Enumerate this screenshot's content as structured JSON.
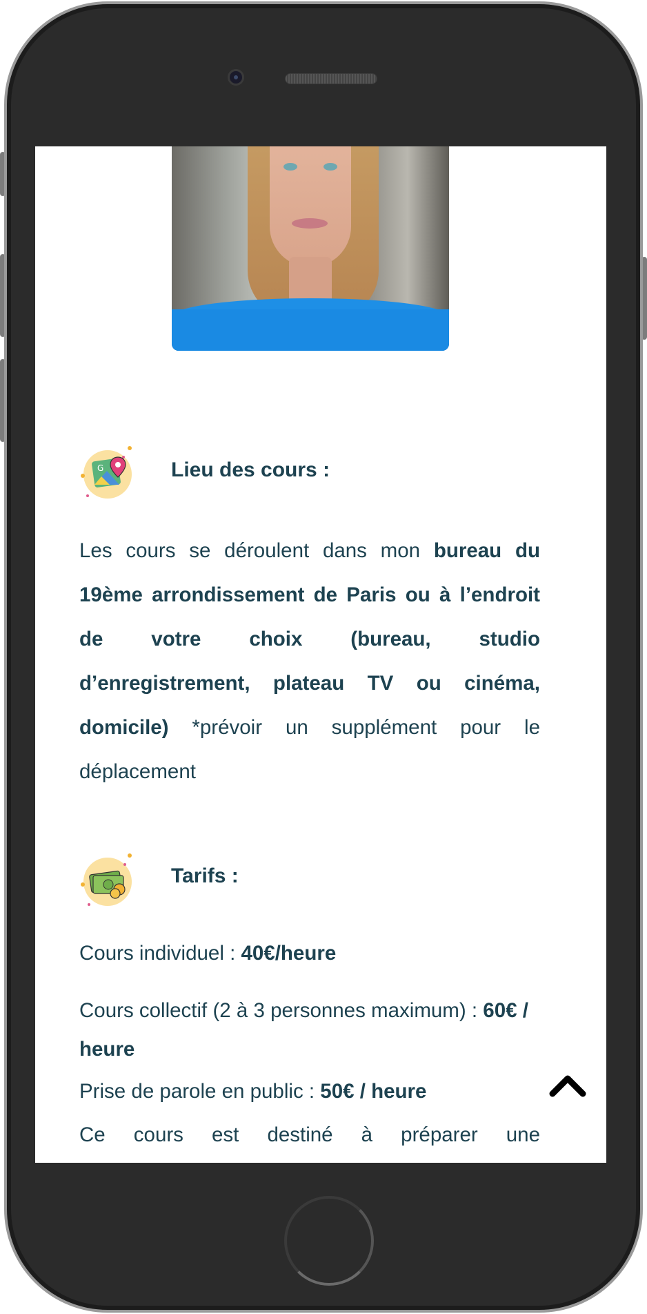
{
  "location": {
    "title": "Lieu des cours :",
    "icon": "map-pin-icon",
    "text_plain_1": "Les cours se déroulent dans mon ",
    "text_bold": "bureau du 19ème arrondissement de Paris ou à l’endroit de votre choix (bureau, studio d’enregistrement, plateau TV ou cinéma, domicile)",
    "text_plain_2": " *prévoir un supplément pour le déplacement"
  },
  "pricing": {
    "title": "Tarifs :",
    "icon": "money-icon",
    "individual_label": "Cours individuel : ",
    "individual_price": "40€/heure",
    "group_label": "Cours collectif (2 à 3 personnes maximum) : ",
    "group_price": "60€ / heure",
    "public_label": "Prise de parole en public : ",
    "public_price": "50€ / heure",
    "description_start": "Ce cours est destiné à préparer une"
  },
  "scroll_top": {
    "icon": "chevron-up-icon"
  },
  "colors": {
    "text": "#1d4250",
    "icon_bg": "#fbe1a1",
    "shirt": "#1e8fe6"
  }
}
